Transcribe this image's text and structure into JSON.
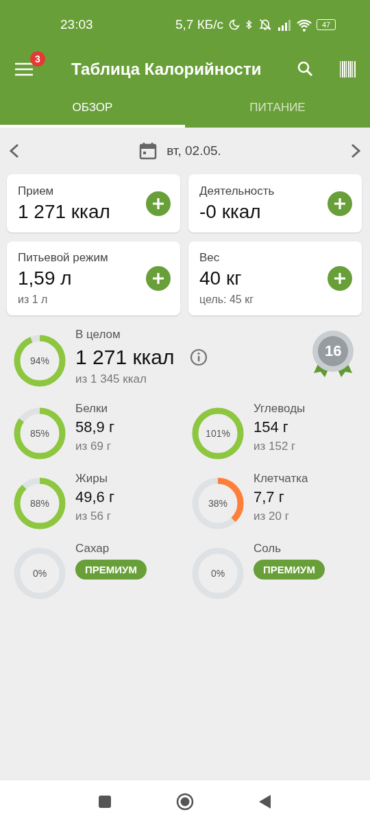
{
  "status_bar": {
    "time": "23:03",
    "net_speed": "5,7 КБ/с",
    "battery": "47"
  },
  "app_bar": {
    "title": "Таблица Калорийности",
    "notification_count": "3"
  },
  "tabs": [
    {
      "label": "ОБЗОР",
      "selected": true
    },
    {
      "label": "ПИТАНИЕ",
      "selected": false
    }
  ],
  "date": "вт, 02.05.",
  "cards": [
    {
      "label": "Прием",
      "value": "1 271 ккал"
    },
    {
      "label": "Деятельность",
      "value": "-0 ккал"
    },
    {
      "label": "Питьевой режим",
      "value": "1,59 л",
      "note": "из 1 л"
    },
    {
      "label": "Вес",
      "value": "40 кг",
      "note": "цель: 45 кг"
    }
  ],
  "overall": {
    "label": "В целом",
    "value": "1 271 ккал",
    "goal": "из 1 345 ккал",
    "percent": "94%",
    "color": "#8dc63f",
    "medal": "16"
  },
  "nutrients": [
    {
      "kind": "tracked",
      "name": "Белки",
      "value": "58,9 г",
      "goal": "из 69 г",
      "percent": "85%",
      "color": "#8dc63f"
    },
    {
      "kind": "tracked",
      "name": "Углеводы",
      "value": "154 г",
      "goal": "из 152 г",
      "percent": "101%",
      "color": "#8dc63f"
    },
    {
      "kind": "tracked",
      "name": "Жиры",
      "value": "49,6 г",
      "goal": "из 56 г",
      "percent": "88%",
      "color": "#8dc63f"
    },
    {
      "kind": "tracked",
      "name": "Клетчатка",
      "value": "7,7 г",
      "goal": "из 20 г",
      "percent": "38%",
      "color": "#ff7f3a"
    },
    {
      "kind": "premium",
      "name": "Сахар",
      "button": "ПРЕМИУМ",
      "percent": "0%"
    },
    {
      "kind": "premium",
      "name": "Соль",
      "button": "ПРЕМИУМ",
      "percent": "0%"
    }
  ]
}
